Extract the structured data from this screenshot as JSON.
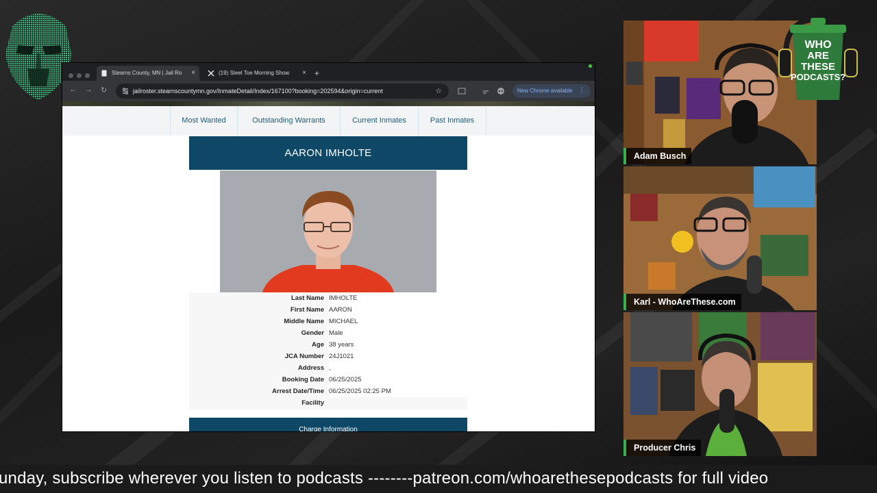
{
  "browser": {
    "tabs": [
      {
        "label": "Stearns County, MN | Jail Ro",
        "active": true,
        "icon": "page-icon"
      },
      {
        "label": "(19) Steel Toe Morning Show",
        "active": false,
        "icon": "x-logo-icon"
      }
    ],
    "url": "jailroster.stearnscountymn.gov/InmateDetail/Index/167100?booking=202594&origin=current",
    "update_label": "New Chrome available",
    "colors": {
      "tabbar": "#1f2023",
      "toolbar": "#35363a",
      "update_pill": "#394457"
    }
  },
  "site": {
    "nav": [
      "Most Wanted",
      "Outstanding Warrants",
      "Current Inmates",
      "Past Inmates"
    ],
    "inmate_name": "AARON IMHOLTE",
    "details": [
      {
        "label": "Last Name",
        "value": "IMHOLTE"
      },
      {
        "label": "First Name",
        "value": "AARON"
      },
      {
        "label": "Middle Name",
        "value": "MICHAEL"
      },
      {
        "label": "Gender",
        "value": "Male"
      },
      {
        "label": "Age",
        "value": "38 years"
      },
      {
        "label": "JCA Number",
        "value": "24J1021"
      },
      {
        "label": "Address",
        "value": ","
      },
      {
        "label": "Booking Date",
        "value": "06/25/2025"
      },
      {
        "label": "Arrest Date/Time",
        "value": "06/25/2025 02:25 PM"
      },
      {
        "label": "Facility",
        "value": ""
      }
    ],
    "charges_banner": "Charge Information",
    "colors": {
      "banner": "#0f4766",
      "nav_text": "#1c5a75"
    }
  },
  "video": {
    "participants": [
      {
        "name": "Adam Busch"
      },
      {
        "name": "Karl - WhoAreThese.com"
      },
      {
        "name": "Producer Chris"
      }
    ],
    "logo_lines": [
      "WHO",
      "ARE",
      "THESE",
      "PODCASTS?"
    ],
    "accent": "#34b34a"
  },
  "ticker": {
    "text": "unday, subscribe wherever you listen to podcasts --------patreon.com/whoarethesepodcasts for full video"
  }
}
